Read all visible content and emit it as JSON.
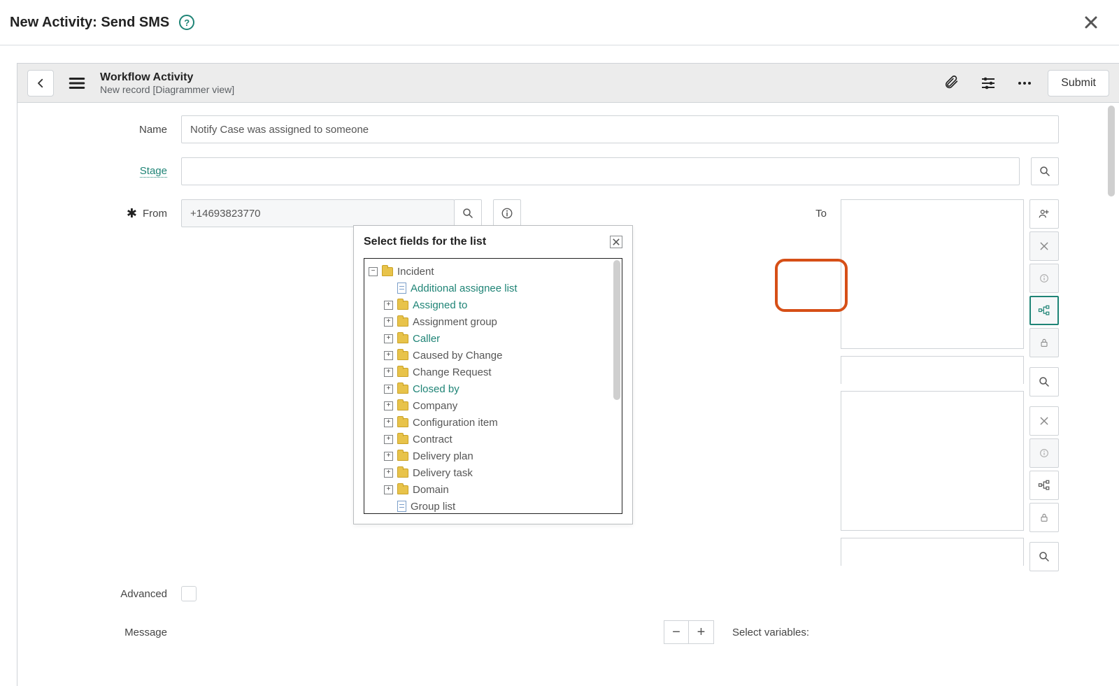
{
  "dialog": {
    "title": "New Activity: Send SMS"
  },
  "header": {
    "title": "Workflow Activity",
    "subtitle": "New record [Diagrammer view]",
    "submit": "Submit"
  },
  "form": {
    "name_label": "Name",
    "name_value": "Notify Case was assigned to someone",
    "stage_label": "Stage",
    "stage_value": "",
    "from_label": "From",
    "from_value": "+14693823770",
    "to_label": "To",
    "advanced_label": "Advanced",
    "message_label": "Message",
    "select_variables_label": "Select variables:"
  },
  "popup": {
    "title": "Select fields for the list",
    "root": "Incident",
    "items": [
      {
        "kind": "doc",
        "label": "Additional assignee list",
        "link": true,
        "expand": ""
      },
      {
        "kind": "folder",
        "label": "Assigned to",
        "link": true,
        "expand": "+"
      },
      {
        "kind": "folder",
        "label": "Assignment group",
        "link": false,
        "expand": "+"
      },
      {
        "kind": "folder",
        "label": "Caller",
        "link": true,
        "expand": "+"
      },
      {
        "kind": "folder",
        "label": "Caused by Change",
        "link": false,
        "expand": "+"
      },
      {
        "kind": "folder",
        "label": "Change Request",
        "link": false,
        "expand": "+"
      },
      {
        "kind": "folder",
        "label": "Closed by",
        "link": true,
        "expand": "+"
      },
      {
        "kind": "folder",
        "label": "Company",
        "link": false,
        "expand": "+"
      },
      {
        "kind": "folder",
        "label": "Configuration item",
        "link": false,
        "expand": "+"
      },
      {
        "kind": "folder",
        "label": "Contract",
        "link": false,
        "expand": "+"
      },
      {
        "kind": "folder",
        "label": "Delivery plan",
        "link": false,
        "expand": "+"
      },
      {
        "kind": "folder",
        "label": "Delivery task",
        "link": false,
        "expand": "+"
      },
      {
        "kind": "folder",
        "label": "Domain",
        "link": false,
        "expand": "+"
      },
      {
        "kind": "doc",
        "label": "Group list",
        "link": false,
        "expand": ""
      }
    ]
  }
}
